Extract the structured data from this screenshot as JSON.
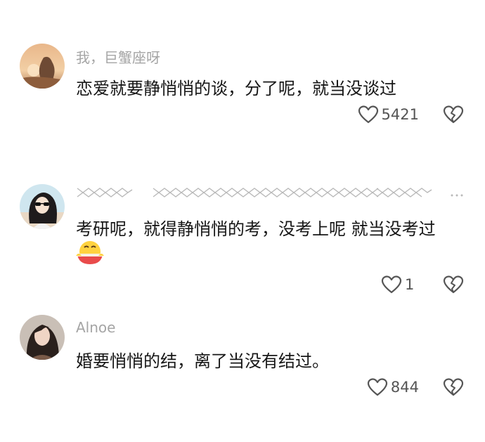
{
  "comments": [
    {
      "username": "我，巨蟹座呀",
      "text": "恋爱就要静悄悄的谈，分了呢，就当没谈过",
      "likes": "5421",
      "avatar_icon": "sunset-photo-avatar"
    },
    {
      "username": "",
      "text": "考研呢，就得静悄悄的考，没考上呢  就当没考过",
      "likes": "1",
      "avatar_icon": "cartoon-girl-sunglasses-avatar",
      "emoji_icon": "face-holding-bowl-emoji"
    },
    {
      "username": "Alnoe",
      "text": "婚要悄悄的结，离了当没有结过。",
      "likes": "844",
      "avatar_icon": "woman-portrait-avatar"
    }
  ],
  "colors": {
    "text": "#161616",
    "username": "#a5a5a5",
    "icon": "#555555"
  }
}
